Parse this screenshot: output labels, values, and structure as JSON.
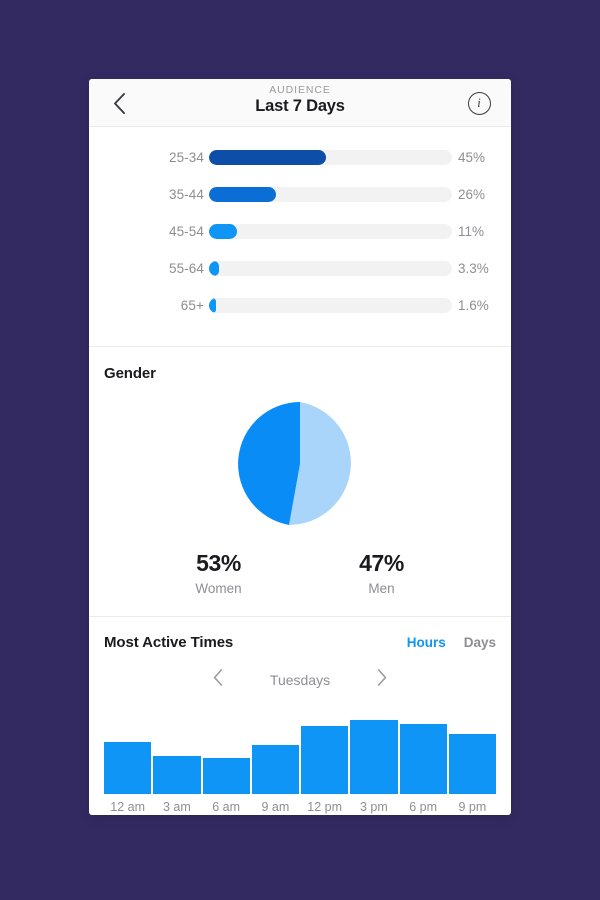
{
  "theme": {
    "page_bg": "#342A62",
    "card_bg": "#ffffff",
    "accent": "#0f95f5",
    "muted_text": "#8e8e93",
    "dark_text": "#1b1b1f",
    "track_bg": "#f2f2f3"
  },
  "header": {
    "kicker": "AUDIENCE",
    "title": "Last 7 Days",
    "back_icon": "chevron-left-icon",
    "info_icon": "info-circle-icon",
    "info_glyph": "i"
  },
  "age_section": {
    "rows": [
      {
        "label": "25-34",
        "percent": "45%",
        "value": 45,
        "bar_width_pct": 48.0,
        "color": "#0d4ea8"
      },
      {
        "label": "35-44",
        "percent": "26%",
        "value": 26,
        "bar_width_pct": 27.6,
        "color": "#0a6ed6"
      },
      {
        "label": "45-54",
        "percent": "11%",
        "value": 11,
        "bar_width_pct": 11.7,
        "color": "#0f95f5"
      },
      {
        "label": "55-64",
        "percent": "3.3%",
        "value": 3.3,
        "bar_width_pct": 4.1,
        "color": "#0f95f5"
      },
      {
        "label": "65+",
        "percent": "1.6%",
        "value": 1.6,
        "bar_width_pct": 2.9,
        "color": "#0f95f5"
      }
    ]
  },
  "gender_section": {
    "title": "Gender",
    "stats": [
      {
        "value": "53%",
        "label": "Women",
        "color": "#0a8cf7"
      },
      {
        "value": "47%",
        "label": "Men",
        "color": "#a8d5f9"
      }
    ]
  },
  "times_section": {
    "title": "Most Active Times",
    "toggle_hours": "Hours",
    "toggle_days": "Days",
    "selected_toggle": "Hours",
    "prev_icon": "chevron-left-icon",
    "next_icon": "chevron-right-icon",
    "current_day": "Tuesdays"
  },
  "chart_data": [
    {
      "type": "bar",
      "title": "Audience age distribution",
      "orientation": "horizontal",
      "categories": [
        "25-34",
        "35-44",
        "45-54",
        "55-64",
        "65+"
      ],
      "values": [
        45,
        26,
        11,
        3.3,
        1.6
      ],
      "value_labels": [
        "45%",
        "26%",
        "11%",
        "3.3%",
        "1.6%"
      ],
      "xlabel": "",
      "ylabel": "",
      "xlim": [
        0,
        100
      ],
      "grid": false,
      "legend": "none"
    },
    {
      "type": "pie",
      "title": "Gender",
      "categories": [
        "Women",
        "Men"
      ],
      "values": [
        53,
        47
      ],
      "value_labels": [
        "53%",
        "47%"
      ],
      "colors": [
        "#0a8cf7",
        "#a8d5f9"
      ],
      "legend": "below"
    },
    {
      "type": "bar",
      "title": "Most Active Times",
      "subtitle": "Tuesdays",
      "orientation": "vertical",
      "categories": [
        "12 am",
        "3 am",
        "6 am",
        "9 am",
        "12 pm",
        "3 pm",
        "6 pm",
        "9 pm"
      ],
      "values": [
        67,
        49,
        46,
        63,
        87,
        95,
        90,
        77
      ],
      "xlabel": "",
      "ylabel": "",
      "ylim": [
        0,
        100
      ],
      "grid": false,
      "legend": "none",
      "color": "#0f95f5"
    }
  ]
}
